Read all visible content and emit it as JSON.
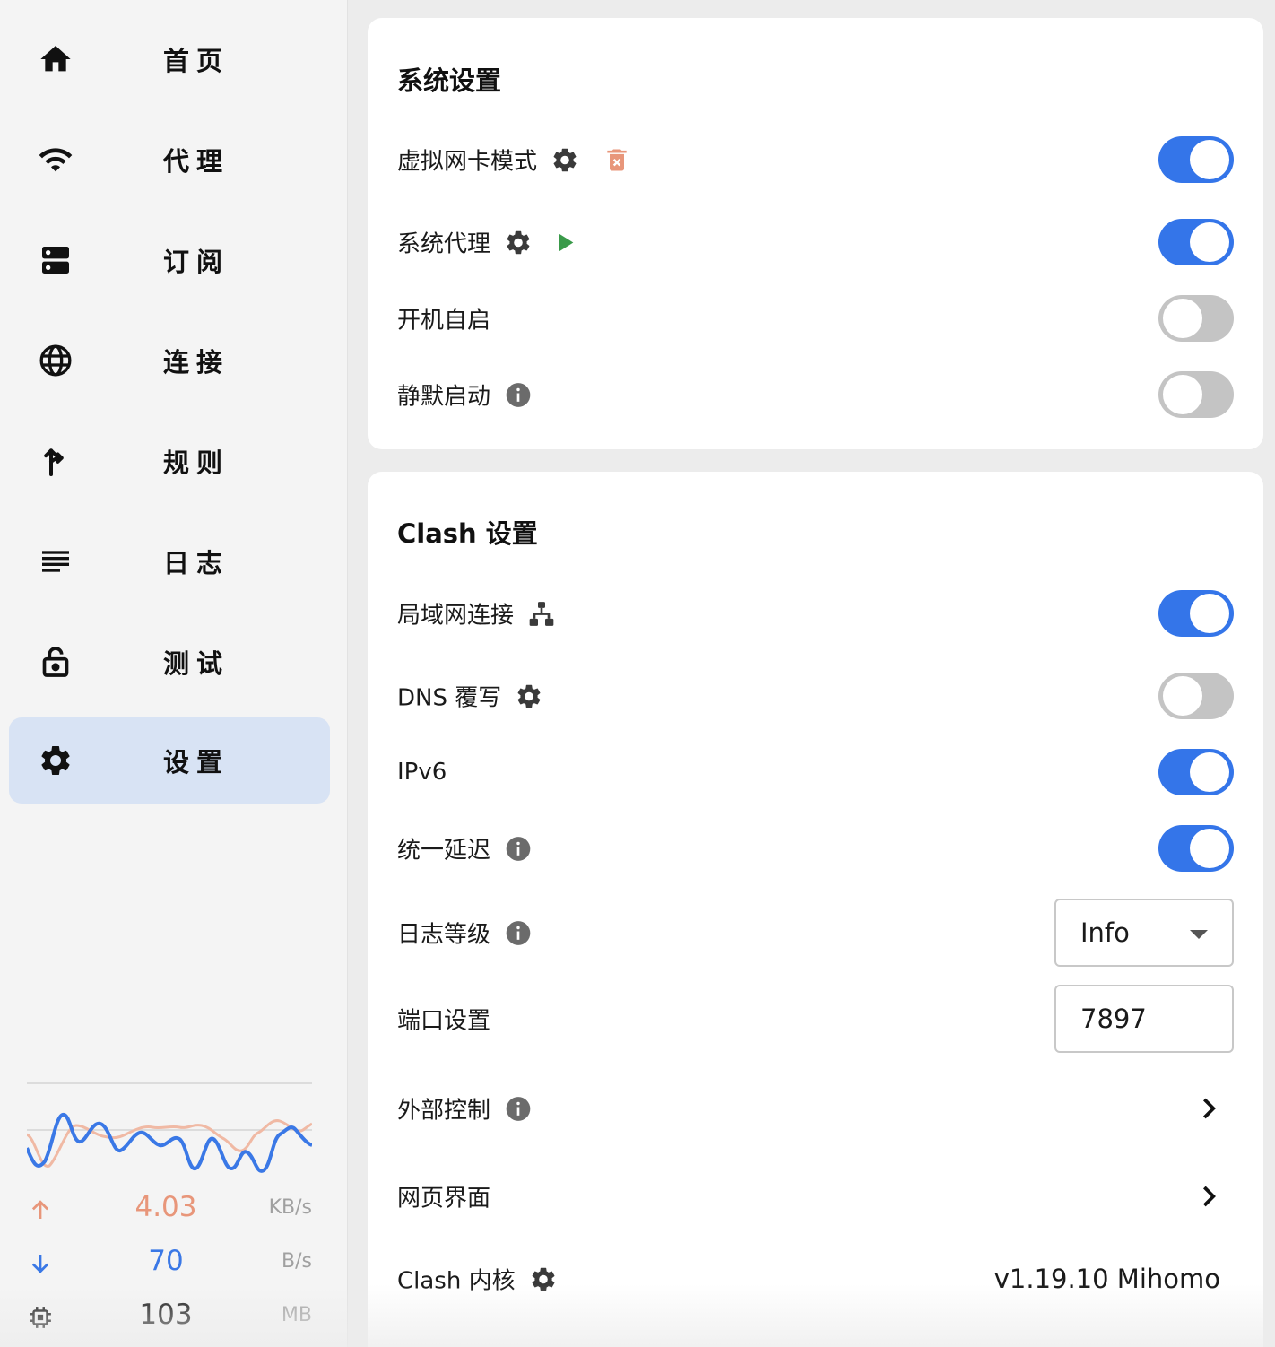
{
  "nav": {
    "items": [
      {
        "label": "首页",
        "icon": "home-icon"
      },
      {
        "label": "代理",
        "icon": "wifi-icon"
      },
      {
        "label": "订阅",
        "icon": "dns-icon"
      },
      {
        "label": "连接",
        "icon": "globe-icon"
      },
      {
        "label": "规则",
        "icon": "fork-right-icon"
      },
      {
        "label": "日志",
        "icon": "notes-icon"
      },
      {
        "label": "测试",
        "icon": "lock-open-icon"
      },
      {
        "label": "设置",
        "icon": "settings-icon"
      }
    ],
    "active": "设置"
  },
  "traffic": {
    "upload": {
      "value": "4.03",
      "unit": "KB/s",
      "color": "#e8967a"
    },
    "download": {
      "value": "70",
      "unit": "B/s",
      "color": "#3a78e6"
    },
    "memory": {
      "value": "103",
      "unit": "MB"
    }
  },
  "system": {
    "title": "系统设置",
    "tun": {
      "label": "虚拟网卡模式",
      "enabled": true
    },
    "sysproxy": {
      "label": "系统代理",
      "enabled": true
    },
    "autostart": {
      "label": "开机自启",
      "enabled": false
    },
    "silent": {
      "label": "静默启动",
      "enabled": false
    }
  },
  "clash": {
    "title": "Clash 设置",
    "lan": {
      "label": "局域网连接",
      "enabled": true
    },
    "dns": {
      "label": "DNS 覆写",
      "enabled": false
    },
    "ipv6": {
      "label": "IPv6",
      "enabled": true
    },
    "unified_delay": {
      "label": "统一延迟",
      "enabled": true
    },
    "log_level": {
      "label": "日志等级",
      "value": "Info"
    },
    "port": {
      "label": "端口设置",
      "value": "7897"
    },
    "external": {
      "label": "外部控制"
    },
    "webui": {
      "label": "网页界面"
    },
    "core": {
      "label": "Clash 内核",
      "version": "v1.19.10 Mihomo"
    }
  },
  "colors": {
    "accent": "#3475e9",
    "toggle_off": "#c4c4c4",
    "active_nav": "#d8e3f4",
    "delete_icon": "#e8967a",
    "play_icon": "#3a9a4a"
  }
}
